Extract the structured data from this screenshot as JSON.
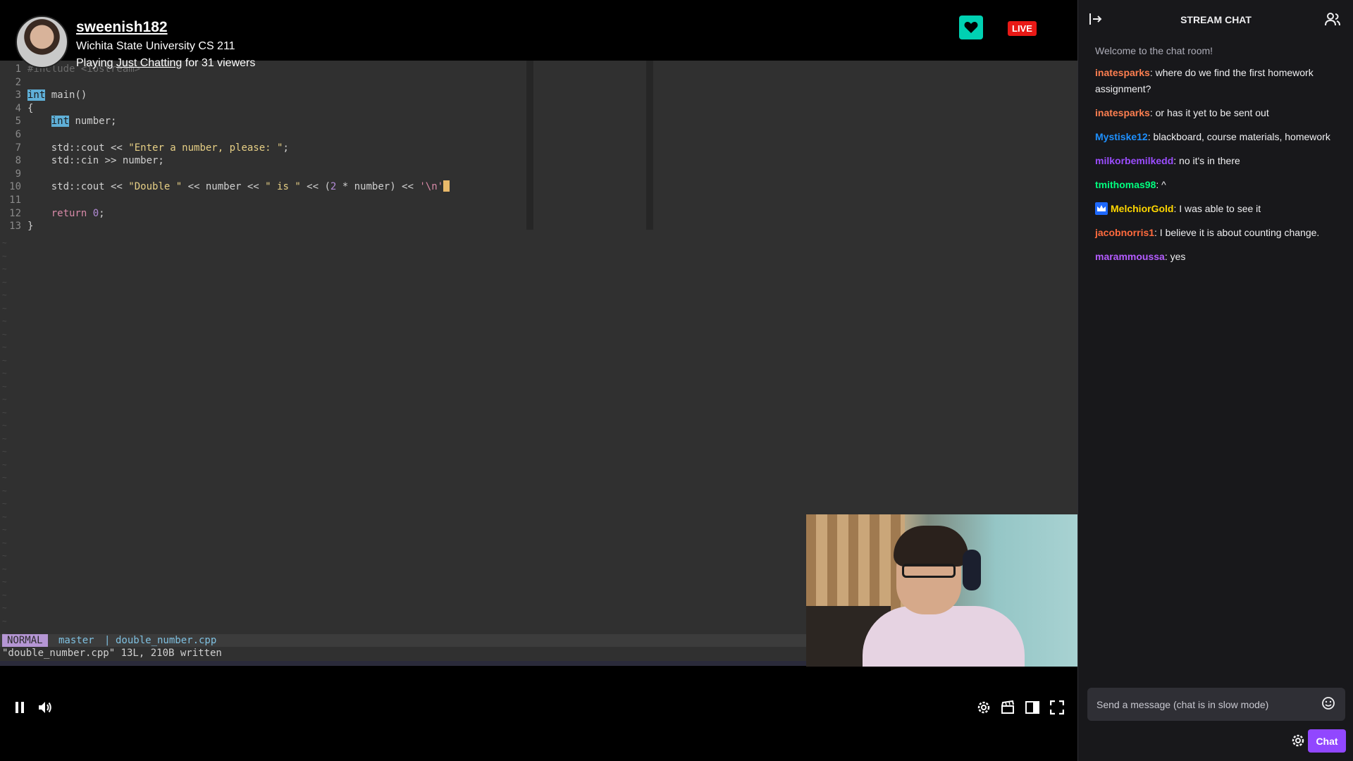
{
  "channel": {
    "streamer": "sweenish182",
    "title": "Wichita State University CS 211",
    "playing_prefix": "Playing ",
    "game": "Just Chatting",
    "playing_suffix": " for 31 viewers",
    "live_label": "LIVE"
  },
  "editor": {
    "lines": [
      {
        "n": "1",
        "text": "#include <iostream>"
      },
      {
        "n": "2",
        "text": ""
      },
      {
        "n": "3",
        "text": "int main()"
      },
      {
        "n": "4",
        "text": "{"
      },
      {
        "n": "5",
        "text": "    int number;"
      },
      {
        "n": "6",
        "text": ""
      },
      {
        "n": "7",
        "text": "    std::cout << \"Enter a number, please: \";"
      },
      {
        "n": "8",
        "text": "    std::cin >> number;"
      },
      {
        "n": "9",
        "text": ""
      },
      {
        "n": "10",
        "text": "    std::cout << \"Double \" << number << \" is \" << (2 * number) << '\\n'"
      },
      {
        "n": "11",
        "text": ""
      },
      {
        "n": "12",
        "text": "    return 0;"
      },
      {
        "n": "13",
        "text": "}"
      }
    ],
    "mode": "NORMAL",
    "branch": "master",
    "separator": "|",
    "file": "double_number.cpp",
    "message": "\"double_number.cpp\" 13L, 210B written"
  },
  "controls": {
    "pause_icon": "pause-icon",
    "volume_icon": "volume-icon",
    "settings_icon": "gear-icon",
    "clip_icon": "clapperboard-icon",
    "theatre_icon": "theatre-mode-icon",
    "fullscreen_icon": "fullscreen-icon"
  },
  "chat": {
    "title": "STREAM CHAT",
    "welcome": "Welcome to the chat room!",
    "messages": [
      {
        "user": "inatesparks",
        "color": "#ff7f50",
        "text": ": where do we find the first homework assignment?"
      },
      {
        "user": "inatesparks",
        "color": "#ff7f50",
        "text": ": or has it yet to be sent out"
      },
      {
        "user": "Mystiske12",
        "color": "#1e90ff",
        "text": ": blackboard, course materials, homework"
      },
      {
        "user": "milkorbemilkedd",
        "color": "#9b4dff",
        "text": ": no it's in there"
      },
      {
        "user": "tmithomas98",
        "color": "#00ff7f",
        "text": ": ^"
      },
      {
        "user": "MelchiorGold",
        "color": "#ffd700",
        "text": ": I was able to see it",
        "badge": true
      },
      {
        "user": "jacobnorris1",
        "color": "#ff6a3d",
        "text": ": I believe it is about counting change."
      },
      {
        "user": "marammoussa",
        "color": "#b45cff",
        "text": ": yes"
      }
    ],
    "input_placeholder": "Send a message (chat is in slow mode)",
    "send_label": "Chat"
  },
  "colors": {
    "accent": "#9147ff",
    "live": "#e91916",
    "follow": "#00d1b2"
  }
}
